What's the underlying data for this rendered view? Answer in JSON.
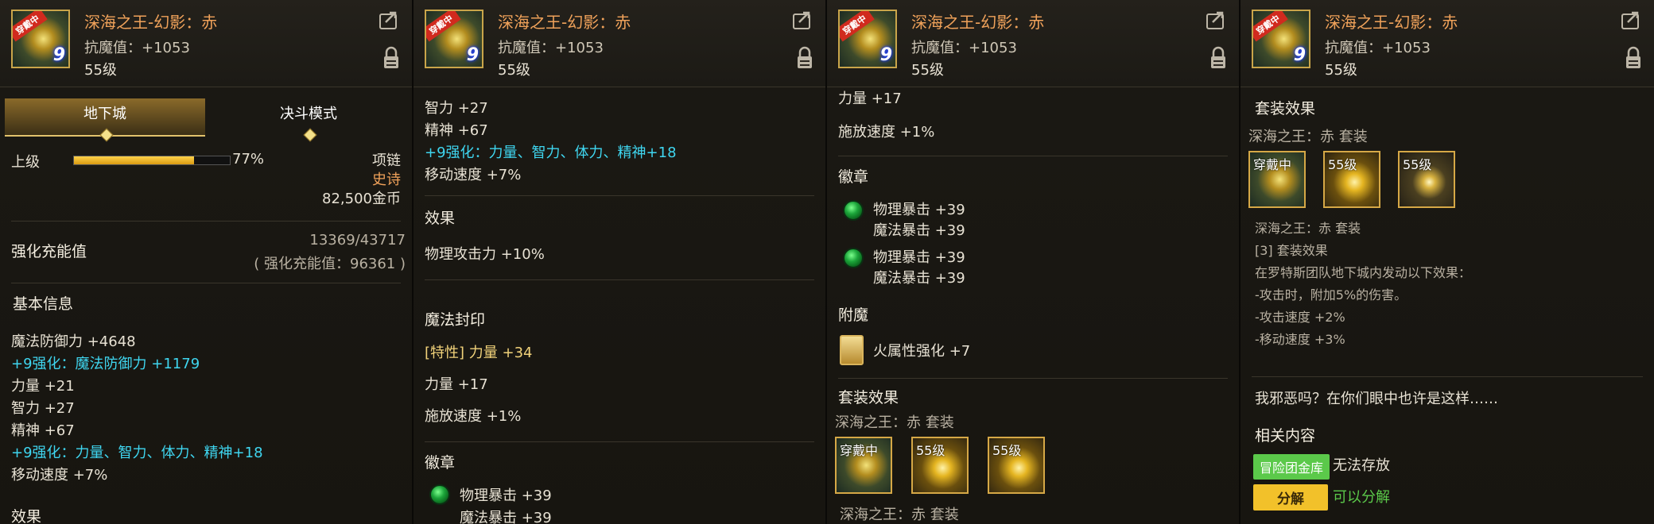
{
  "header": {
    "name": "深海之王-幻影：赤",
    "stat": "抗魔值：+1053",
    "level": "55级",
    "icon_tag": "穿戴中",
    "icon_level": "9"
  },
  "panel1": {
    "tabs": [
      "地下城",
      "决斗模式"
    ],
    "grade_label": "上级",
    "grade_percent": "77%",
    "grade_fraction": 0.77,
    "slot_type": "项链",
    "rarity": "史诗",
    "price": "82,500金币",
    "charge_title": "强化充能值",
    "charge_ratio": "13369/43717",
    "charge_sub": "( 强化充能值：96361 )",
    "basic_title": "基本信息",
    "lines": [
      "魔法防御力 +4648",
      "+9强化：魔法防御力 +1179",
      "力量 +21",
      "智力 +27",
      "精神 +67",
      "+9强化：力量、智力、体力、精神+18",
      "移动速度 +7%"
    ],
    "cut_title": "效果"
  },
  "panel2": {
    "lines_top": [
      "智力 +27",
      "精神 +67",
      "+9强化：力量、智力、体力、精神+18",
      "移动速度 +7%"
    ],
    "effect_title": "效果",
    "effect_line": "物理攻击力 +10%",
    "seal_title": "魔法封印",
    "seal_lines": [
      "[特性] 力量 +34",
      "力量 +17",
      "施放速度 +1%"
    ],
    "emblem_title": "徽章",
    "emblem_line": "物理暴击 +39",
    "emblem_cut": "魔法暴击 +39"
  },
  "panel3": {
    "lines_top": [
      "力量 +17",
      "施放速度 +1%"
    ],
    "emblem_title": "徽章",
    "emblems": [
      [
        "物理暴击 +39",
        "魔法暴击 +39"
      ],
      [
        "物理暴击 +39",
        "魔法暴击 +39"
      ]
    ],
    "enchant_title": "附魔",
    "enchant_line": "火属性强化 +7",
    "set_title": "套装效果",
    "set_name": "深海之王：赤  套装",
    "slot_levels": [
      "55级",
      "55级"
    ],
    "set_cut": "深海之王：赤  套装"
  },
  "panel4": {
    "set_title": "套装效果",
    "set_name": "深海之王：赤  套装",
    "slot_levels": [
      "55级",
      "55级"
    ],
    "set_name2": "深海之王：赤  套装",
    "set_effect_title": "[3] 套装效果",
    "set_effect_lines": [
      "在罗特斯团队地下城内发动以下效果：",
      "-攻击时，附加5%的伤害。",
      "-攻击速度 +2%",
      "-移动速度 +3%"
    ],
    "flavor": "我邪恶吗？在你们眼中也许是这样……",
    "related_title": "相关内容",
    "storage_button": "冒险团金库",
    "storage_status": "无法存放",
    "disassemble_button": "分解",
    "disassemble_status": "可以分解"
  },
  "colors": {
    "item_name": "#f0a25a",
    "enhance": "#3fd6f0",
    "rarity": "#f0a25a",
    "set_yellow": "#f2c12a",
    "green_btn": "#5bc94a"
  }
}
